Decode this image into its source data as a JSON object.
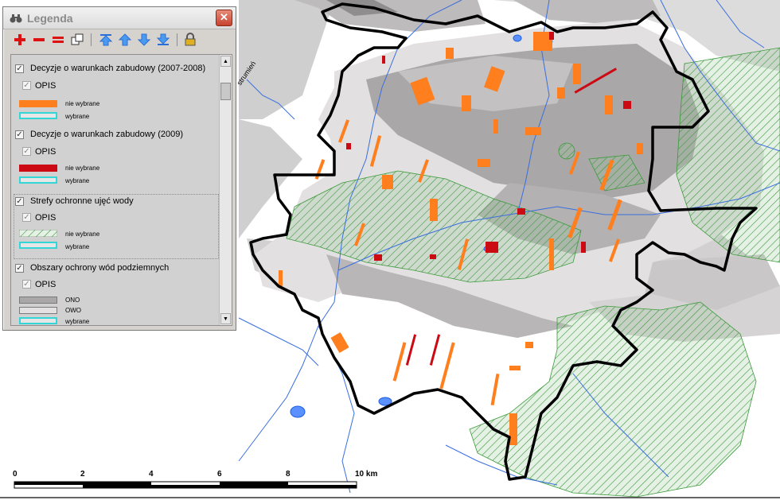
{
  "legend": {
    "title": "Legenda",
    "close_label": "✕",
    "toolbar": [
      "add-layer-icon",
      "remove-layer-icon",
      "remove-all-icon",
      "copy-icon",
      "move-top-icon",
      "move-up-icon",
      "move-down-icon",
      "move-bottom-icon",
      "lock-icon"
    ],
    "layers": [
      {
        "name": "Decyzje o warunkach zabudowy (2007-2008)",
        "checked": true,
        "sub": "OPIS",
        "items": [
          {
            "label": "nie wybrane",
            "fill": "#ff7f1e"
          },
          {
            "label": "wybrane",
            "fill": "#e6e6e6",
            "border": "#33d6d6"
          }
        ]
      },
      {
        "name": "Decyzje o warunkach zabudowy (2009)",
        "checked": true,
        "sub": "OPIS",
        "items": [
          {
            "label": "nie wybrane",
            "fill": "#cc0a14"
          },
          {
            "label": "wybrane",
            "fill": "#e6e6e6",
            "border": "#33d6d6"
          }
        ]
      },
      {
        "name": "Strefy ochronne ujęć wody",
        "checked": true,
        "sub": "OPIS",
        "items": [
          {
            "label": "nie wybrane",
            "fill": "hatch-green"
          },
          {
            "label": "wybrane",
            "fill": "#e6e6e6",
            "border": "#33d6d6"
          }
        ]
      },
      {
        "name": "Obszary ochrony wód podziemnych",
        "checked": true,
        "sub": "OPIS",
        "items": [
          {
            "label": "ONO",
            "fill": "#a9a7a7"
          },
          {
            "label": "OWO",
            "fill": "#e2e0e0"
          },
          {
            "label": "wybrane",
            "fill": "#e6e6e6",
            "border": "#33d6d6"
          }
        ]
      }
    ]
  },
  "map": {
    "river_label": "strumień",
    "scale_labels": [
      "0",
      "2",
      "4",
      "6",
      "8",
      "10 km"
    ],
    "colors": {
      "ono": "#a9a7a7",
      "owo": "#e2e0e0",
      "background_gray": "#d4d4d4",
      "boundary": "#000000",
      "orange_plots": "#ff7f1e",
      "red_plots": "#cc0a14",
      "water": "#1f5fe0",
      "protection_zone": "#3a9a3a"
    }
  }
}
